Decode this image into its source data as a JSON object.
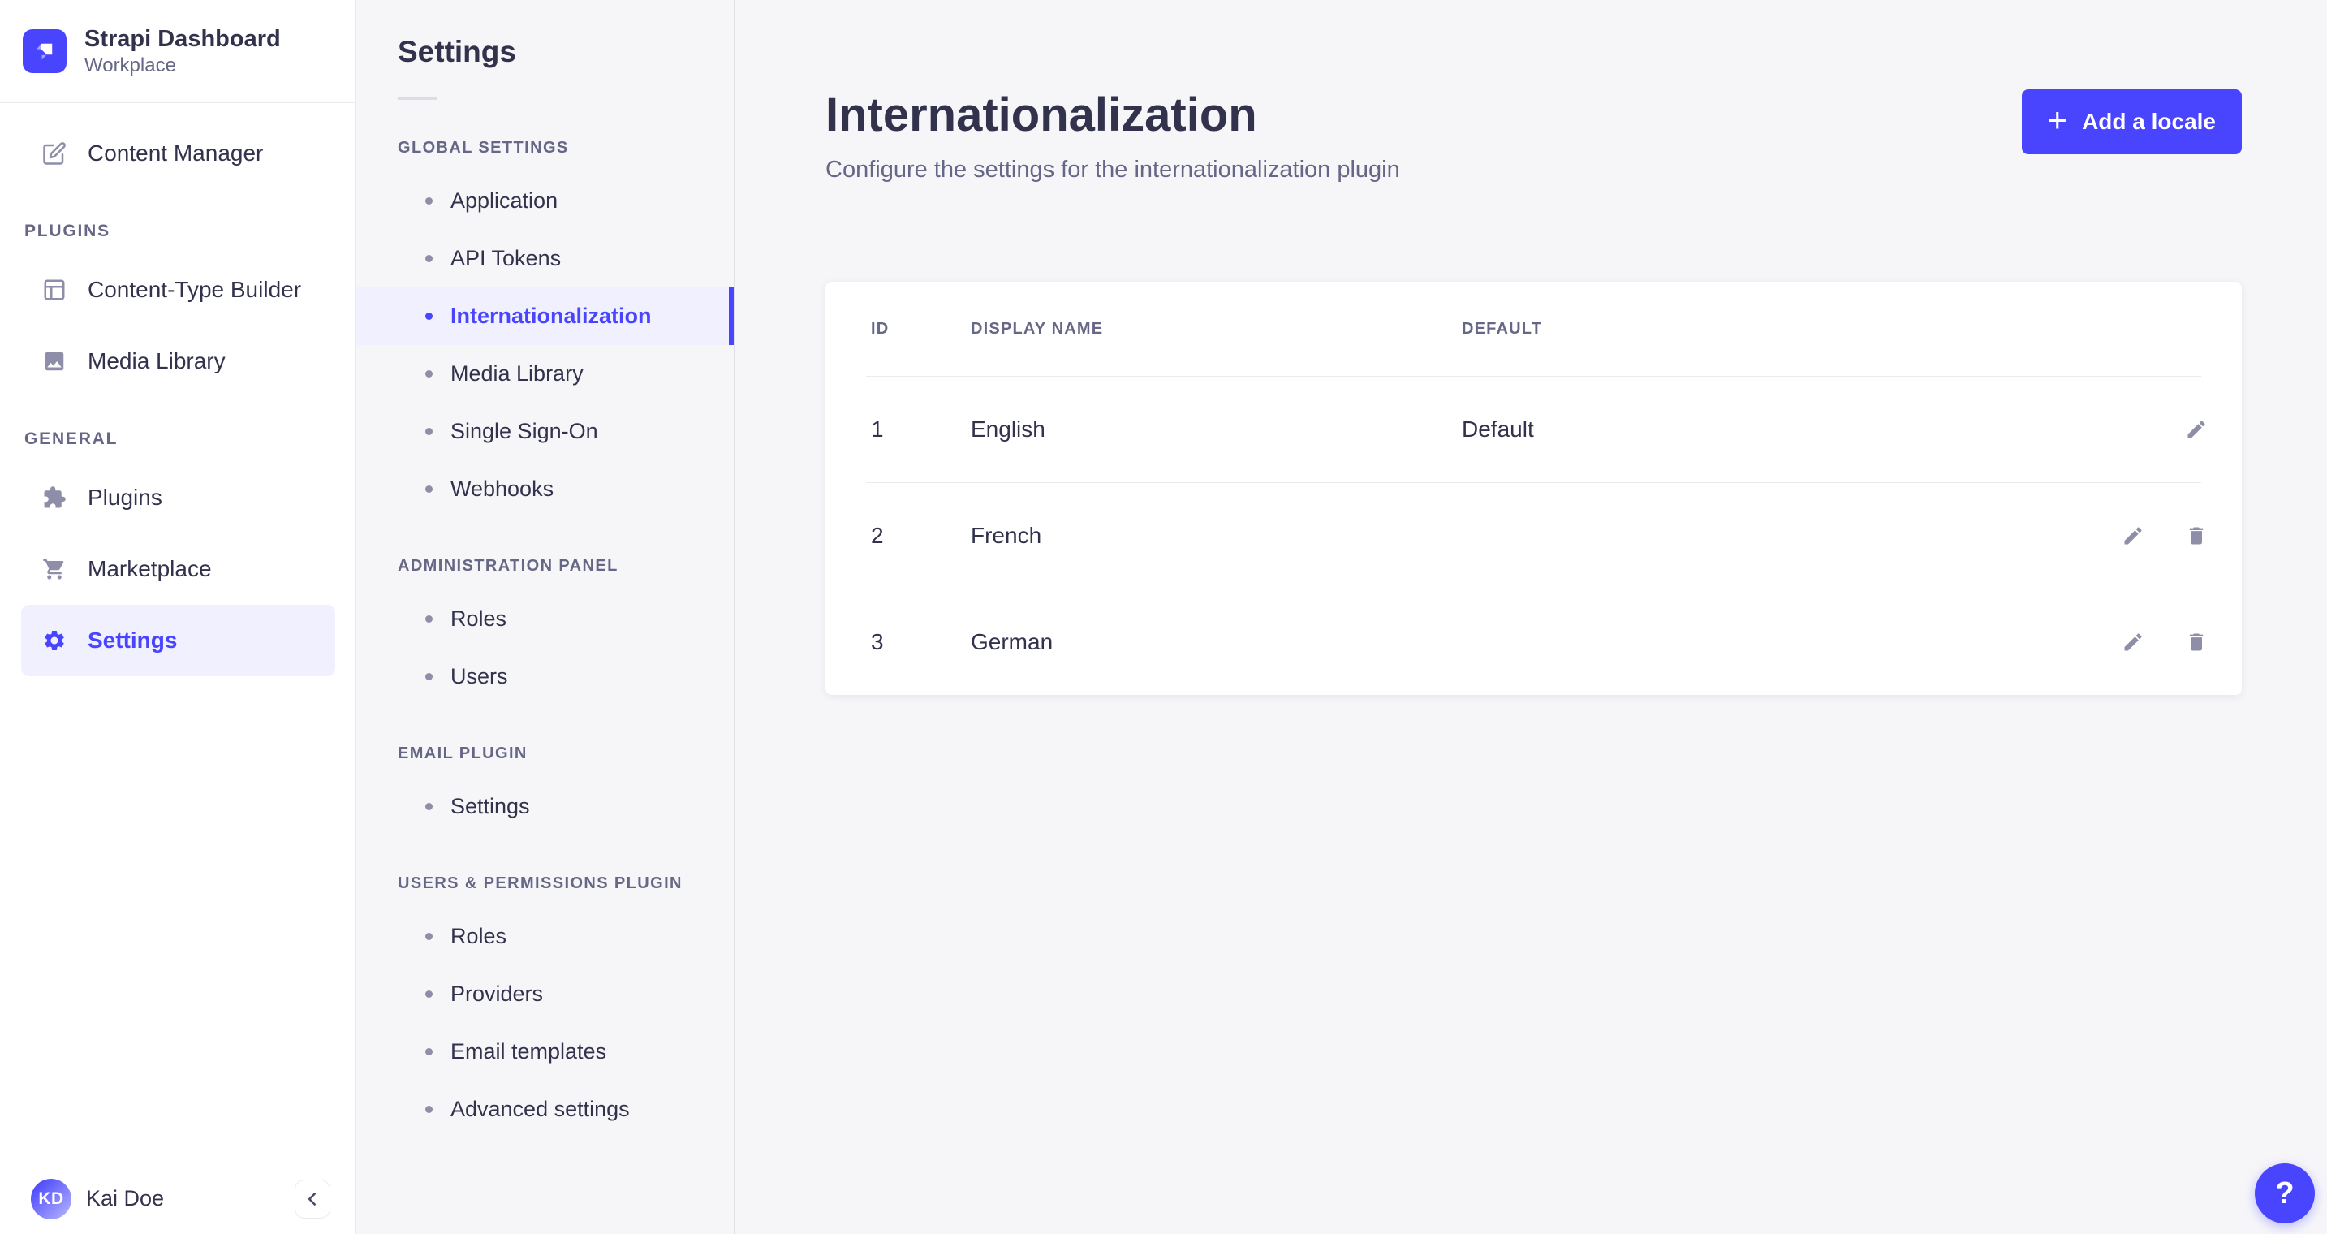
{
  "brand": {
    "title": "Strapi Dashboard",
    "subtitle": "Workplace"
  },
  "main_nav": {
    "sections": [
      {
        "label": null,
        "items": [
          {
            "label": "Content Manager",
            "icon": "edit-square"
          }
        ]
      },
      {
        "label": "PLUGINS",
        "items": [
          {
            "label": "Content-Type Builder",
            "icon": "layout"
          },
          {
            "label": "Media Library",
            "icon": "image"
          }
        ]
      },
      {
        "label": "GENERAL",
        "items": [
          {
            "label": "Plugins",
            "icon": "puzzle"
          },
          {
            "label": "Marketplace",
            "icon": "cart"
          },
          {
            "label": "Settings",
            "icon": "gear",
            "active": true
          }
        ]
      }
    ]
  },
  "user": {
    "initials": "KD",
    "name": "Kai Doe"
  },
  "subnav": {
    "title": "Settings",
    "sections": [
      {
        "label": "GLOBAL SETTINGS",
        "items": [
          {
            "label": "Application"
          },
          {
            "label": "API Tokens"
          },
          {
            "label": "Internationalization",
            "active": true
          },
          {
            "label": "Media Library"
          },
          {
            "label": "Single Sign-On"
          },
          {
            "label": "Webhooks"
          }
        ]
      },
      {
        "label": "ADMINISTRATION PANEL",
        "items": [
          {
            "label": "Roles"
          },
          {
            "label": "Users"
          }
        ]
      },
      {
        "label": "EMAIL PLUGIN",
        "items": [
          {
            "label": "Settings"
          }
        ]
      },
      {
        "label": "USERS & PERMISSIONS PLUGIN",
        "items": [
          {
            "label": "Roles"
          },
          {
            "label": "Providers"
          },
          {
            "label": "Email templates"
          },
          {
            "label": "Advanced settings"
          }
        ]
      }
    ]
  },
  "page": {
    "title": "Internationalization",
    "subtitle": "Configure the settings for the internationalization plugin",
    "add_locale_button": "Add a locale",
    "add_icon_glyph": "+"
  },
  "table": {
    "headers": [
      "ID",
      "DISPLAY NAME",
      "DEFAULT"
    ],
    "rows": [
      {
        "id": "1",
        "display_name": "English",
        "default": "Default",
        "actions": [
          "edit"
        ]
      },
      {
        "id": "2",
        "display_name": "French",
        "default": "",
        "actions": [
          "edit",
          "delete"
        ]
      },
      {
        "id": "3",
        "display_name": "German",
        "default": "",
        "actions": [
          "edit",
          "delete"
        ]
      }
    ]
  },
  "help_button_label": "?",
  "colors": {
    "primary": "#4945FF",
    "primary_bg": "#F0F0FF",
    "text": "#32324D",
    "muted": "#666687",
    "icon": "#8E8EA9",
    "border": "#EAEAEF",
    "surface": "#FFFFFF",
    "app_bg": "#F6F6F9"
  }
}
